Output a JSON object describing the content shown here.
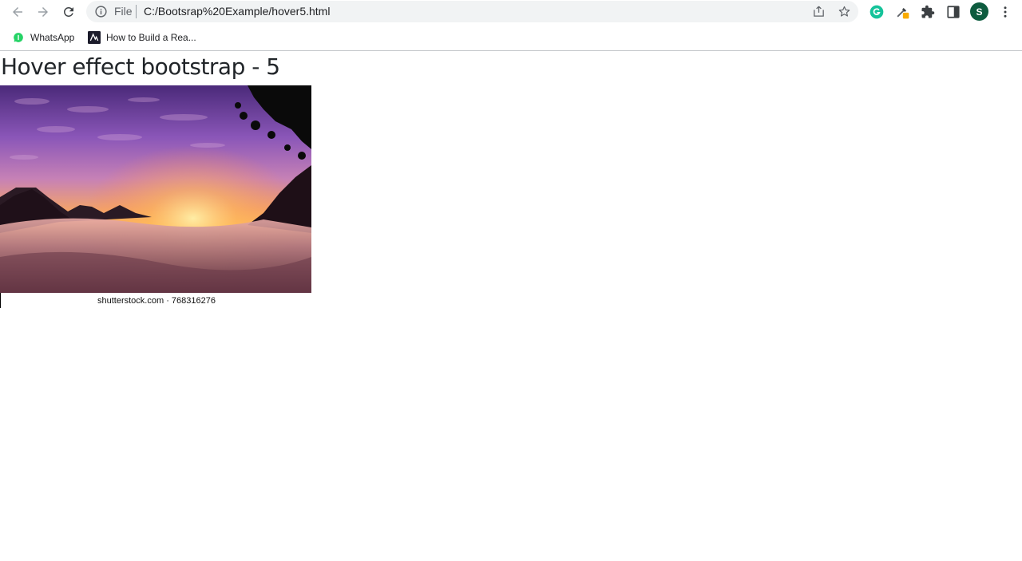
{
  "browser": {
    "omnibox": {
      "scheme_label": "File",
      "url": "C:/Bootsrap%20Example/hover5.html"
    },
    "profile": {
      "initial": "S"
    },
    "icons": {
      "back": "arrow-left-icon",
      "forward": "arrow-right-icon",
      "reload": "reload-icon",
      "site_info": "info-icon",
      "share": "share-icon",
      "bookmark_star": "star-icon",
      "grammarly": "grammarly-icon",
      "eyedropper": "eyedropper-icon",
      "extensions": "puzzle-icon",
      "side_panel": "side-panel-icon",
      "menu": "more-vert-icon"
    },
    "accent": "#1a73e8"
  },
  "bookmarks": [
    {
      "label": "WhatsApp",
      "icon": "whatsapp-icon"
    },
    {
      "label": "How to Build a Rea...",
      "icon": "site-logo-icon"
    }
  ],
  "page": {
    "title": "Hover effect bootstrap - 5",
    "image_credit": "shutterstock.com · 768316276"
  }
}
